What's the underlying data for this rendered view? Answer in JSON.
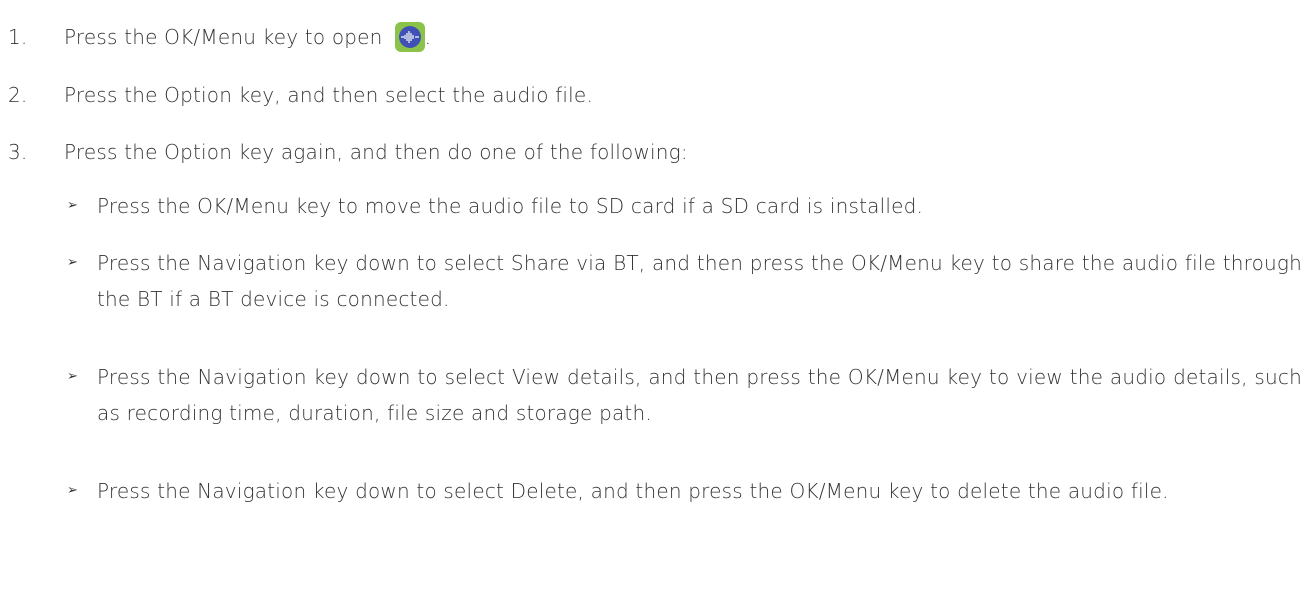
{
  "steps": [
    {
      "number": "1.",
      "text": "Press the OK/Menu key to open",
      "after_icon": ".",
      "icon": "voice-recorder-app-icon"
    },
    {
      "number": "2.",
      "text": "Press the Option key, and then select the audio file."
    },
    {
      "number": "3.",
      "text": "Press the Option key again, and then do one of the following:"
    }
  ],
  "bullets": [
    {
      "marker": "➢",
      "text": "Press the OK/Menu key to move the audio file to SD card if a SD card is installed."
    },
    {
      "marker": "➢",
      "text": "Press the Navigation key down to select Share via BT, and then press the OK/Menu key to share the audio file through the BT if a BT device is connected."
    },
    {
      "marker": "➢",
      "text": "Press the Navigation key down to select View details, and then press the OK/Menu key to view the audio details, such as recording time, duration, file size and storage path."
    },
    {
      "marker": "➢",
      "text": "Press the Navigation key down to select Delete, and then press the OK/Menu key to delete the audio file."
    }
  ],
  "colors": {
    "text": "#333333",
    "icon_background": "#8bc34a",
    "icon_circle": "#3f51b5"
  }
}
